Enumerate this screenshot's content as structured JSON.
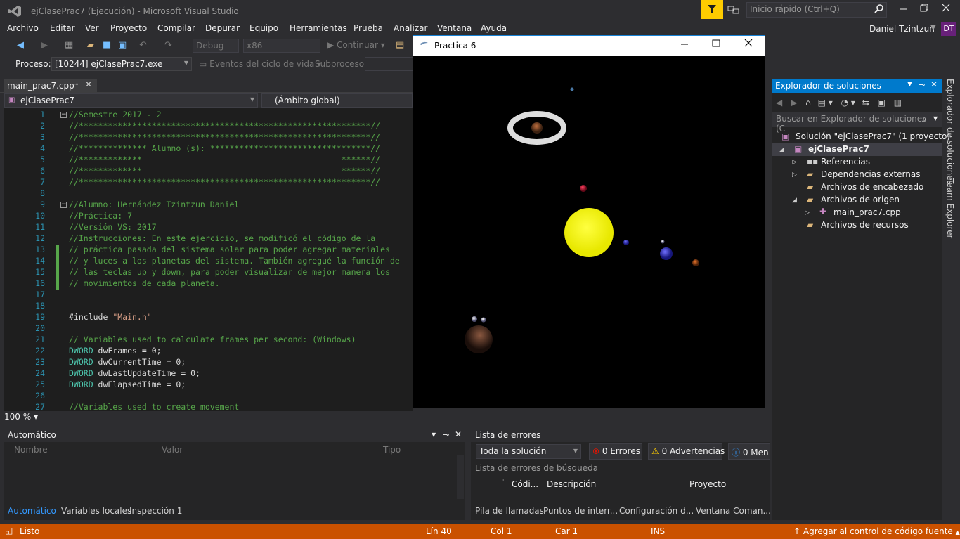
{
  "window": {
    "title": "ejClasePrac7 (Ejecución) - Microsoft Visual Studio",
    "quick_launch_placeholder": "Inicio rápido (Ctrl+Q)"
  },
  "menu": [
    "Archivo",
    "Editar",
    "Ver",
    "Proyecto",
    "Compilar",
    "Depurar",
    "Equipo",
    "Herramientas",
    "Prueba",
    "Analizar",
    "Ventana",
    "Ayuda"
  ],
  "user": {
    "name": "Daniel Tzintzun",
    "initials": "DT"
  },
  "toolbar": {
    "config": "Debug",
    "platform": "x86",
    "continue": "Continuar"
  },
  "process_bar": {
    "label": "Proceso:",
    "process": "[10244] ejClasePrac7.exe",
    "lifecycle": "Eventos del ciclo de vida",
    "subprocess": "Subproceso:"
  },
  "editor": {
    "tab": "main_prac7.cpp",
    "nav_left": "ejClasePrac7",
    "nav_right": "(Ámbito global)",
    "zoom": "100 %",
    "lines": [
      {
        "n": "1",
        "t": "//Semestre 2017 - 2",
        "k": "comment"
      },
      {
        "n": "2",
        "t": "//************************************************************//",
        "k": "comment"
      },
      {
        "n": "3",
        "t": "//************************************************************//",
        "k": "comment"
      },
      {
        "n": "4",
        "t": "//************** Alumno (s): *********************************//",
        "k": "comment"
      },
      {
        "n": "5",
        "t": "//*************                                         ******//",
        "k": "comment"
      },
      {
        "n": "6",
        "t": "//*************                                         ******//",
        "k": "comment"
      },
      {
        "n": "7",
        "t": "//************************************************************//",
        "k": "comment"
      },
      {
        "n": "8",
        "t": "",
        "k": "plain"
      },
      {
        "n": "9",
        "t": "//Alumno: Hernández Tzintzun Daniel",
        "k": "comment"
      },
      {
        "n": "10",
        "t": "//Práctica: 7",
        "k": "comment"
      },
      {
        "n": "11",
        "t": "//Versión VS: 2017",
        "k": "comment"
      },
      {
        "n": "12",
        "t": "//Instrucciones: En este ejercicio, se modificó el código de la",
        "k": "comment"
      },
      {
        "n": "13",
        "t": "// práctica pasada del sistema solar para poder agregar materiales",
        "k": "comment"
      },
      {
        "n": "14",
        "t": "// y luces a los planetas del sistema. También agregué la función de",
        "k": "comment"
      },
      {
        "n": "15",
        "t": "// las teclas up y down, para poder visualizar de mejor manera los",
        "k": "comment"
      },
      {
        "n": "16",
        "t": "// movimientos de cada planeta.",
        "k": "comment"
      },
      {
        "n": "17",
        "t": "",
        "k": "plain"
      },
      {
        "n": "18",
        "t": "",
        "k": "plain"
      },
      {
        "n": "19",
        "t": "#include ",
        "k": "include",
        "s": "\"Main.h\""
      },
      {
        "n": "20",
        "t": "",
        "k": "plain"
      },
      {
        "n": "21",
        "t": "// Variables used to calculate frames per second: (Windows)",
        "k": "comment"
      },
      {
        "n": "22",
        "t": " dwFrames = 0;",
        "k": "dword"
      },
      {
        "n": "23",
        "t": " dwCurrentTime = 0;",
        "k": "dword"
      },
      {
        "n": "24",
        "t": " dwLastUpdateTime = 0;",
        "k": "dword"
      },
      {
        "n": "25",
        "t": " dwElapsedTime = 0;",
        "k": "dword"
      },
      {
        "n": "26",
        "t": "",
        "k": "plain"
      },
      {
        "n": "27",
        "t": "//Variables used to create movement",
        "k": "comment"
      }
    ],
    "dword": "DWORD"
  },
  "console": {
    "title": "Practica 6"
  },
  "solution_explorer": {
    "title": "Explorador de soluciones",
    "search_placeholder": "Buscar en Explorador de soluciones (C",
    "items": [
      {
        "label": "Solución \"ejClasePrac7\"  (1 proyecto)"
      },
      {
        "label": "ejClasePrac7"
      },
      {
        "label": "Referencias"
      },
      {
        "label": "Dependencias externas"
      },
      {
        "label": "Archivos de encabezado"
      },
      {
        "label": "Archivos de origen"
      },
      {
        "label": "main_prac7.cpp"
      },
      {
        "label": "Archivos de recursos"
      }
    ],
    "side_tabs": [
      "Explorador de soluciones",
      "Team Explorer"
    ]
  },
  "auto_panel": {
    "title": "Automático",
    "columns": [
      "Nombre",
      "Valor",
      "Tipo"
    ],
    "tabs": [
      "Automático",
      "Variables locales",
      "Inspección 1"
    ]
  },
  "error_panel": {
    "title": "Lista de errores",
    "filter": "Toda la solución",
    "errors": "0 Errores",
    "warnings": "0 Advertencias",
    "messages": "0 Men",
    "search": "Lista de errores de búsqueda",
    "columns": [
      "Códi...",
      "Descripción",
      "Proyecto"
    ],
    "tabs": [
      "Pila de llamadas",
      "Puntos de interr...",
      "Configuración d...",
      "Ventana Coman..."
    ]
  },
  "status": {
    "ready": "Listo",
    "line": "Lín 40",
    "col": "Col 1",
    "car": "Car 1",
    "ins": "INS",
    "source_control": "Agregar al control de código fuente"
  }
}
